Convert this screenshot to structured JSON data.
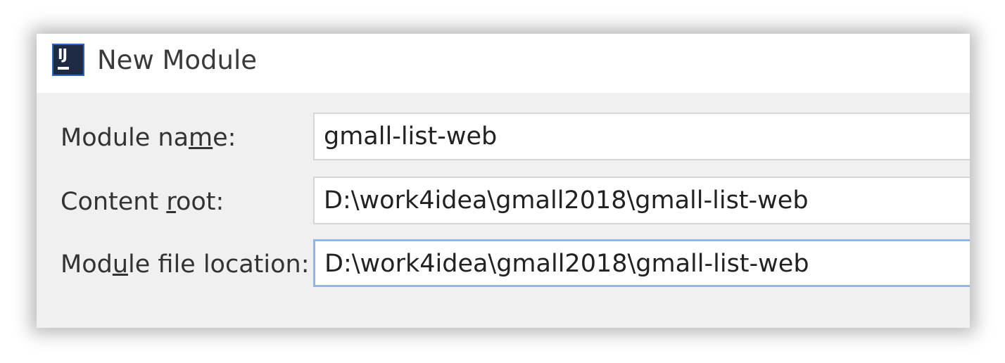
{
  "window": {
    "title": "New Module",
    "icon": "intellij-idea-icon",
    "icon_text": "IJ"
  },
  "form": {
    "module_name": {
      "label_before": "Module na",
      "label_mnemonic": "m",
      "label_after": "e:",
      "value": "gmall-list-web"
    },
    "content_root": {
      "label_before": "Content ",
      "label_mnemonic": "r",
      "label_after": "oot:",
      "value": "D:\\work4idea\\gmall2018\\gmall-list-web"
    },
    "module_file_location": {
      "label_before": "Mod",
      "label_mnemonic": "u",
      "label_after": "le file location:",
      "value": "D:\\work4idea\\gmall2018\\gmall-list-web"
    }
  },
  "colors": {
    "focus_border": "#8fb6e6",
    "icon_background": "#1f2a44"
  }
}
